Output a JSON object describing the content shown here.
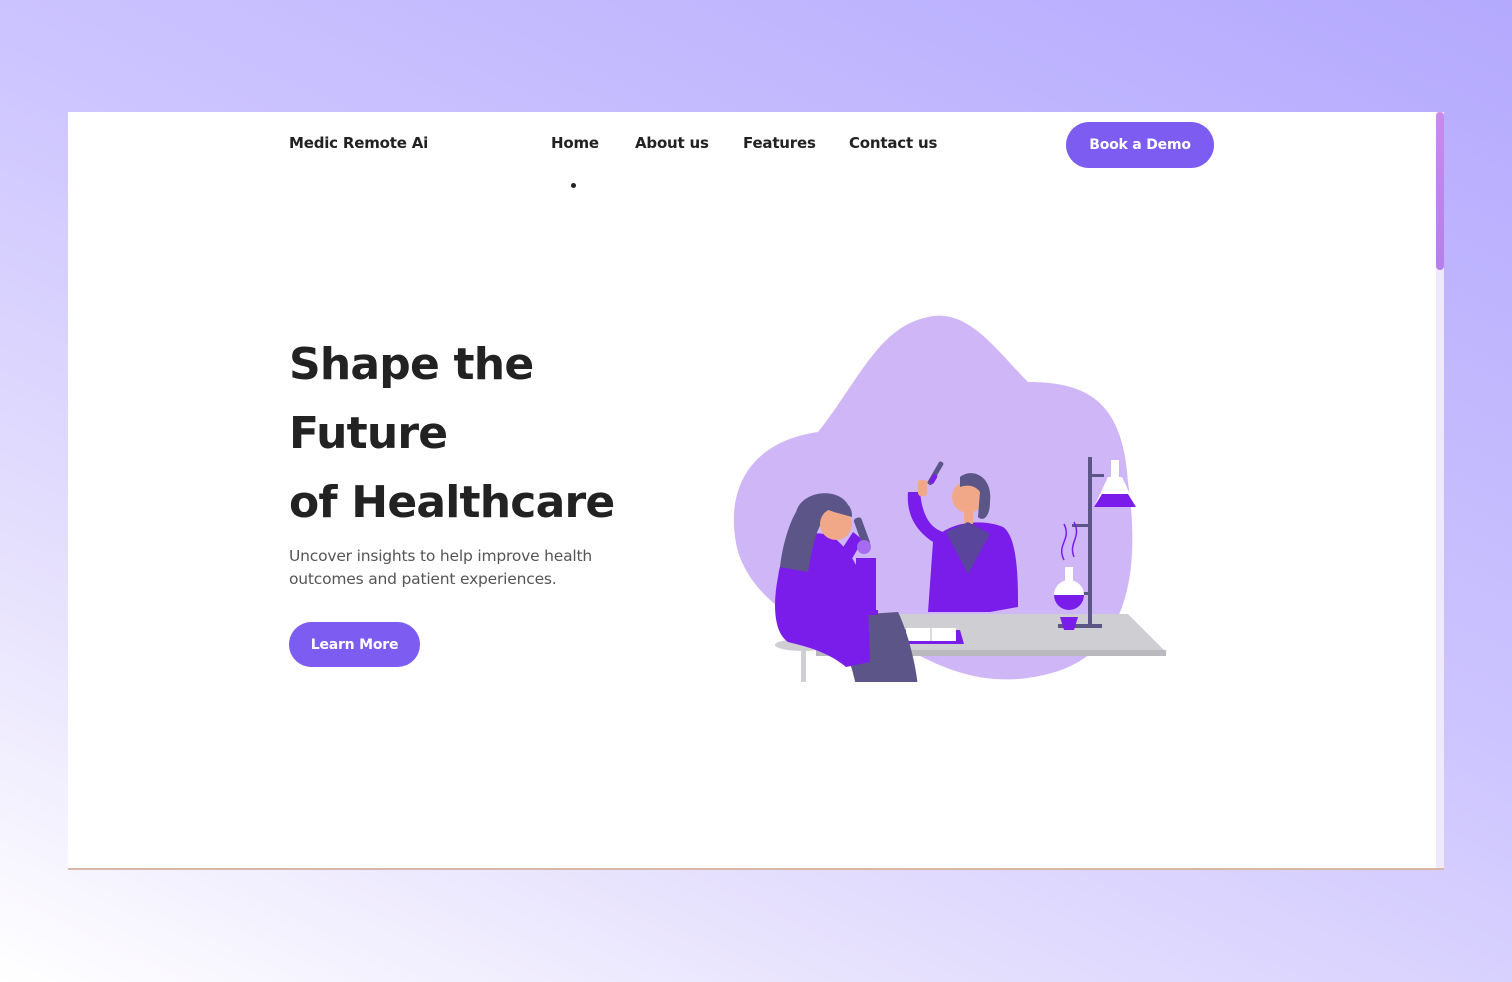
{
  "brand": "Medic Remote Ai",
  "nav": {
    "items": [
      "Home",
      "About us",
      "Features",
      "Contact us"
    ],
    "active": "Home"
  },
  "cta": {
    "demo_label": "Book a Demo"
  },
  "hero": {
    "title_lines": [
      "Shape the",
      "Future",
      "of Healthcare"
    ],
    "subtitle": "Uncover insights to help improve health outcomes and patient experiences.",
    "button_label": "Learn More"
  },
  "colors": {
    "accent": "#7d5cf2",
    "blob": "#cfb7f7",
    "figure_purple": "#7a1dea",
    "text_dark": "#222222"
  },
  "illustration": {
    "subject": "two scientists in a lab",
    "icons": [
      "microscope-icon",
      "flask-icon",
      "test-tube-icon",
      "book-icon"
    ]
  }
}
